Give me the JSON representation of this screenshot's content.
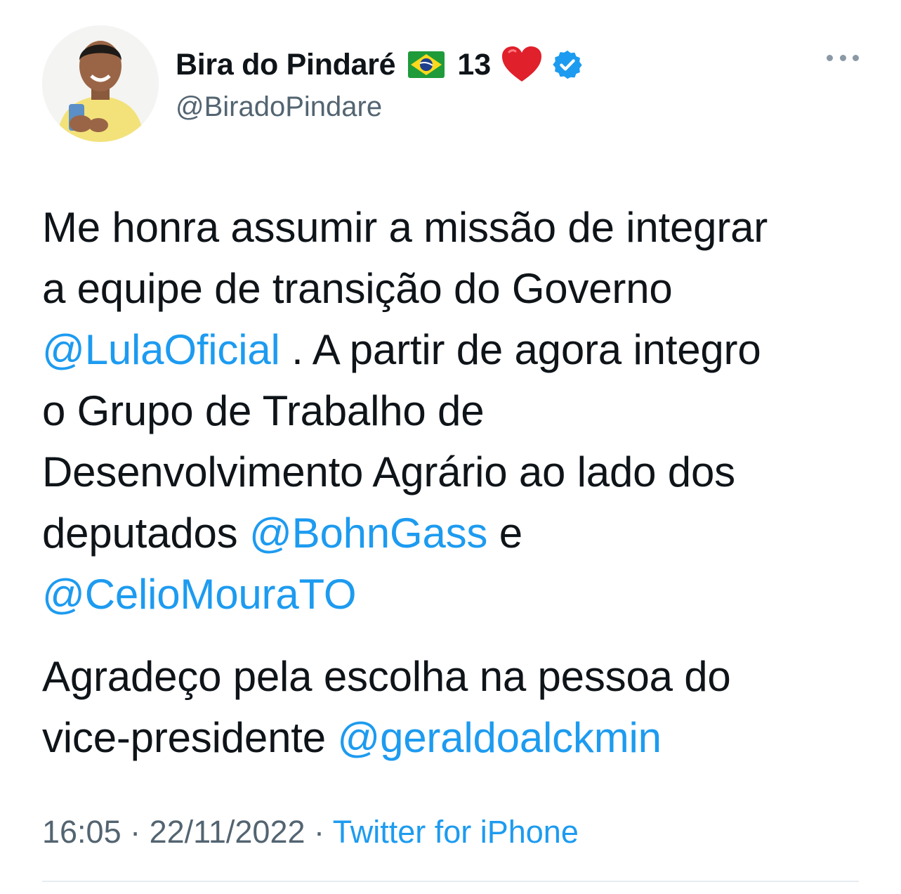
{
  "author": {
    "display_name": "Bira do Pindaré",
    "number": "13",
    "handle": "@BiradoPindare",
    "flag_icon": "brazil-flag-icon",
    "heart_icon": "red-heart-icon",
    "verified_icon": "verified-badge-icon"
  },
  "tweet": {
    "p1_line1": "Me honra assumir a missão de integrar",
    "p1_line2": "a equipe de transição do Governo",
    "mention_lula": "@LulaOficial",
    "p1_line3_rest": " . A partir de agora integro",
    "p1_line4": "o Grupo de Trabalho de",
    "p1_line5": "Desenvolvimento Agrário ao lado dos",
    "p1_line6_start": "deputados ",
    "mention_bohn": "@BohnGass",
    "p1_line6_end": " e",
    "mention_celio": "@CelioMouraTO",
    "p2_line1": "Agradeço pela escolha na pessoa do",
    "p2_line2_start": "vice-presidente ",
    "mention_geraldo": "@geraldoalckmin"
  },
  "meta": {
    "time": "16:05",
    "separator1": " · ",
    "date": "22/11/2022",
    "separator2": " · ",
    "source": "Twitter for iPhone"
  },
  "colors": {
    "link": "#1d9bf0",
    "text": "#0f1419",
    "secondary": "#536471",
    "verified": "#1d9bf0",
    "heart": "#e0202b"
  }
}
